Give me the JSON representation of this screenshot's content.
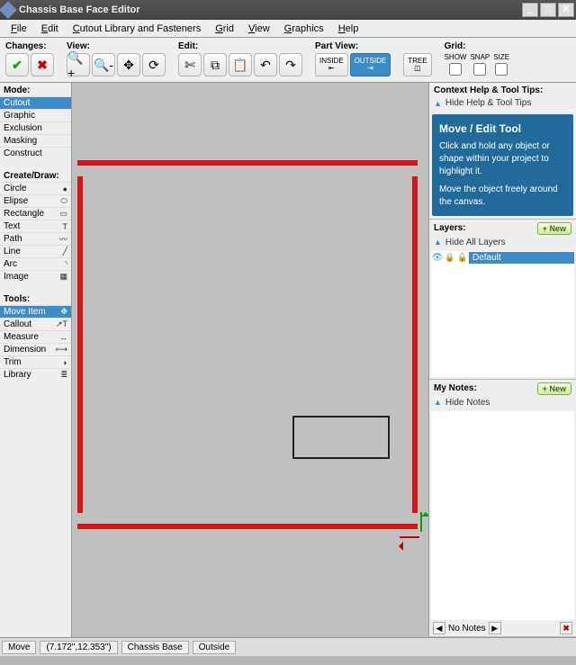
{
  "window": {
    "title": "Chassis Base Face Editor",
    "min": "_",
    "max": "□",
    "close": "X"
  },
  "menubar": [
    {
      "key": "F",
      "label": "ile"
    },
    {
      "key": "E",
      "label": "dit"
    },
    {
      "key": "C",
      "label": "utout Library and Fasteners"
    },
    {
      "key": "G",
      "label": "rid"
    },
    {
      "key": "V",
      "label": "iew"
    },
    {
      "key": "G",
      "label": "raphics"
    },
    {
      "key": "H",
      "label": "elp"
    }
  ],
  "toolbar": {
    "changes": "Changes:",
    "view": "View:",
    "edit": "Edit:",
    "partview": "Part View:",
    "grid": "Grid:",
    "pv_inside": "INSIDE",
    "pv_outside": "OUTSIDE",
    "pv_tree": "TREE",
    "g_show": "SHOW",
    "g_snap": "SNAP",
    "g_size": "SIZE"
  },
  "left": {
    "mode": "Mode:",
    "mode_items": [
      {
        "label": "Cutout",
        "sel": true
      },
      {
        "label": "Graphic"
      },
      {
        "label": "Exclusion"
      },
      {
        "label": "Masking"
      },
      {
        "label": "Construct"
      }
    ],
    "create": "Create/Draw:",
    "create_items": [
      {
        "label": "Circle",
        "ic": "●"
      },
      {
        "label": "Elipse",
        "ic": "⬭"
      },
      {
        "label": "Rectangle",
        "ic": "▭"
      },
      {
        "label": "Text",
        "ic": "T"
      },
      {
        "label": "Path",
        "ic": "〰"
      },
      {
        "label": "Line",
        "ic": "╱"
      },
      {
        "label": "Arc",
        "ic": "◝"
      },
      {
        "label": "Image",
        "ic": "▦"
      }
    ],
    "tools": "Tools:",
    "tool_items": [
      {
        "label": "Move Item",
        "ic": "✥",
        "sel": true
      },
      {
        "label": "Callout",
        "ic": "↗T"
      },
      {
        "label": "Measure",
        "ic": "↔"
      },
      {
        "label": "Dimension",
        "ic": "⟼"
      },
      {
        "label": "Trim",
        "ic": "◗"
      },
      {
        "label": "Library",
        "ic": "≣"
      }
    ]
  },
  "right": {
    "ctx_title": "Context Help & Tool Tips:",
    "ctx_toggle": "Hide Help & Tool Tips",
    "tip_title": "Move / Edit Tool",
    "tip_p1": "Click and hold any object or shape within your project to highlight it.",
    "tip_p2": "Move the object freely around the canvas.",
    "layers_title": "Layers:",
    "new_btn": "+ New",
    "layers_toggle": "Hide All Layers",
    "layer_default": "Default",
    "notes_title": "My Notes:",
    "notes_toggle": "Hide Notes",
    "no_notes": "No Notes"
  },
  "status": {
    "tool": "Move",
    "coords": "(7.172\",12.353\")",
    "part": "Chassis Base",
    "side": "Outside"
  }
}
